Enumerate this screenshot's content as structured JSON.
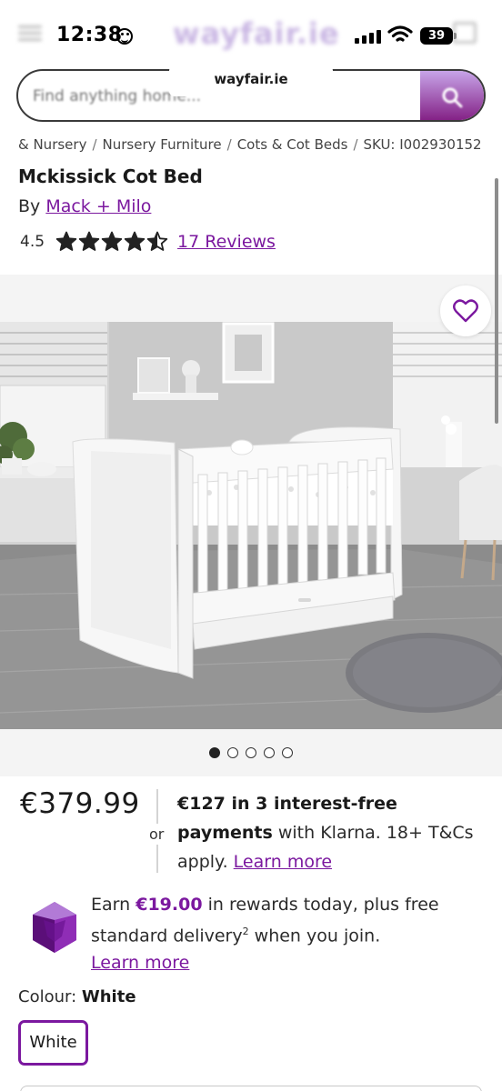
{
  "status_bar": {
    "time": "12:38",
    "battery": "39",
    "icons": [
      "smiley-icon",
      "signal-icon",
      "wifi-icon",
      "battery-icon"
    ]
  },
  "header": {
    "logo": "wayfair.ie",
    "url": "wayfair.ie",
    "search_placeholder": "Find anything home..."
  },
  "breadcrumb": [
    "& Nursery",
    "Nursery Furniture",
    "Cots & Cot Beds"
  ],
  "sku": "SKU: I002930152",
  "product": {
    "title": "Mckissick Cot Bed",
    "by_prefix": "By",
    "brand": "Mack + Milo",
    "rating": "4.5",
    "rating_value": 4.5,
    "rating_max": 5,
    "reviews": "17 Reviews"
  },
  "gallery": {
    "image_count": 5,
    "active_index": 0
  },
  "pricing": {
    "price": "€379.99",
    "or": "or",
    "klarna_amount": "€127 in 3 interest-free",
    "klarna_payments": "payments",
    "klarna_rest": " with Klarna. 18+ T&Cs",
    "klarna_apply": "apply. ",
    "klarna_link": "Learn more"
  },
  "rewards": {
    "earn": "Earn ",
    "amount": "€19.00",
    "text1": " in rewards today, plus free standard delivery",
    "sup": "2",
    "text2": " when you join.",
    "link": "Learn more"
  },
  "colour": {
    "label": "Colour:",
    "value": "White",
    "option": "White"
  },
  "colors": {
    "brand_purple": "#7b189f",
    "text": "#2b2b2b"
  }
}
